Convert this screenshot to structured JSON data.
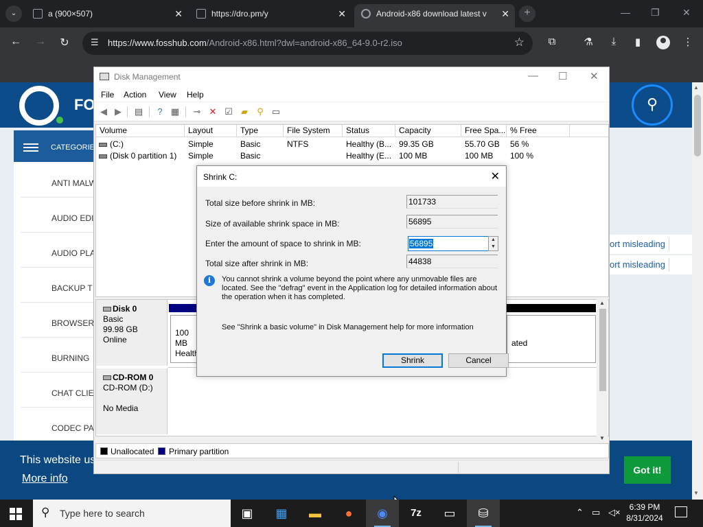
{
  "browser": {
    "tabs": [
      {
        "title": "a (900×507)",
        "active": false
      },
      {
        "title": "https://dro.pm/y",
        "active": false
      },
      {
        "title": "Android-x86 download latest v",
        "active": true
      }
    ],
    "new_tab": "+",
    "url_host": "https://www.fosshub.com",
    "url_path": "/Android-x86.html?dwl=android-x86_64-9.0-r2.iso"
  },
  "website": {
    "logo_text": "FO",
    "categories_label": "CATEGORIE",
    "categories": [
      "ANTI MALW",
      "AUDIO EDI",
      "AUDIO PLA",
      "BACKUP T",
      "BROWSER",
      "BURNING",
      "CHAT CLIE",
      "CODEC PA"
    ],
    "right_links": [
      "ort misleading",
      "ort misleading"
    ],
    "cookie_text": "This website us",
    "cookie_more": "More info",
    "cookie_button": "Got it!"
  },
  "disk_management": {
    "title": "Disk Management",
    "menu": [
      "File",
      "Action",
      "View",
      "Help"
    ],
    "columns": [
      "Volume",
      "Layout",
      "Type",
      "File System",
      "Status",
      "Capacity",
      "Free Spa...",
      "% Free"
    ],
    "volumes": [
      {
        "volume": "(C:)",
        "layout": "Simple",
        "type": "Basic",
        "fs": "NTFS",
        "status": "Healthy (B...",
        "capacity": "99.35 GB",
        "free": "55.70 GB",
        "pct": "56 %"
      },
      {
        "volume": "(Disk 0 partition 1)",
        "layout": "Simple",
        "type": "Basic",
        "fs": "",
        "status": "Healthy (E...",
        "capacity": "100 MB",
        "free": "100 MB",
        "pct": "100 %"
      }
    ],
    "disk0": {
      "name": "Disk 0",
      "type": "Basic",
      "size": "99.98 GB",
      "state": "Online"
    },
    "partition_left": {
      "size": "100 MB",
      "status": "Healthy"
    },
    "partition_right_status": "ated",
    "cdrom": {
      "name": "CD-ROM 0",
      "drive": "CD-ROM (D:)",
      "media": "No Media"
    },
    "legend": [
      {
        "label": "Unallocated",
        "color": "#000000"
      },
      {
        "label": "Primary partition",
        "color": "#000080"
      }
    ]
  },
  "shrink_dialog": {
    "title": "Shrink C:",
    "total_before_label": "Total size before shrink in MB:",
    "total_before_value": "101733",
    "available_label": "Size of available shrink space in MB:",
    "available_value": "56895",
    "amount_label": "Enter the amount of space to shrink in MB:",
    "amount_value": "56895",
    "total_after_label": "Total size after shrink in MB:",
    "total_after_value": "44838",
    "info_text": "You cannot shrink a volume beyond the point where any unmovable files are located. See the \"defrag\" event in the Application log for detailed information about the operation when it has completed.",
    "help_text": "See \"Shrink a basic volume\" in Disk Management help for more information",
    "shrink_button": "Shrink",
    "cancel_button": "Cancel"
  },
  "taskbar": {
    "search_placeholder": "Type here to search",
    "apps": [
      "task-view",
      "store",
      "file-explorer",
      "firefox",
      "chrome",
      "7zip",
      "terminal",
      "disk-management"
    ],
    "app_labels": {
      "sevenzip": "7z"
    },
    "time": "6:39 PM",
    "date": "8/31/2024"
  }
}
